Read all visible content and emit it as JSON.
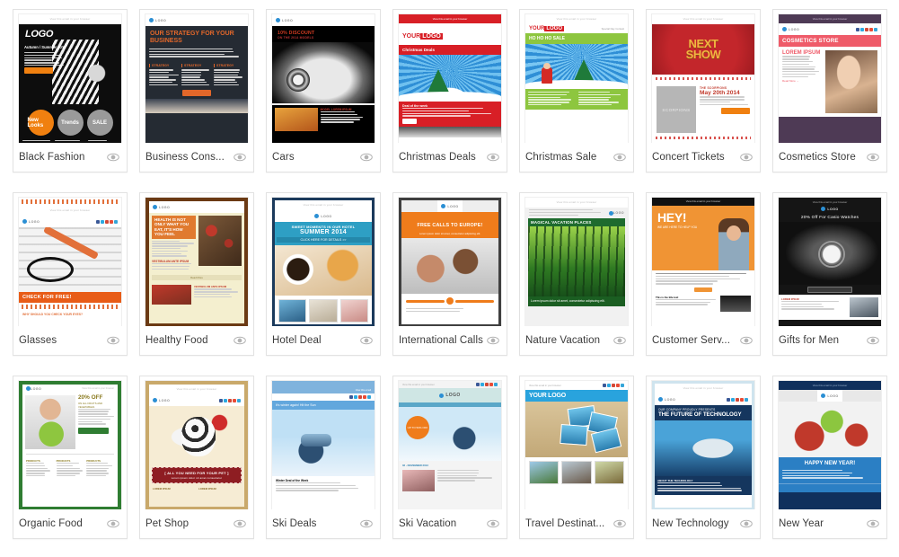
{
  "page": {
    "background": "#ffffff",
    "grid": {
      "columns": 7,
      "rows": 3
    },
    "preview_icon": "eye-icon",
    "preheader_text": "View this email in your browser"
  },
  "templates": [
    {
      "id": "black-fashion",
      "label": "Black Fashion",
      "style": "t-black",
      "accent": "#f08010",
      "thumb": {
        "logo": "LOGO",
        "heading": "Autumn / Summer 2014",
        "badges": [
          "New Looks",
          "Trends",
          "SALE"
        ],
        "cta": "View more"
      }
    },
    {
      "id": "business-consulting",
      "label": "Business Cons...",
      "style": "t-biz",
      "accent": "#e2672a",
      "thumb": {
        "logo": "LOGO",
        "heading": "OUR STRATEGY FOR YOUR BUSINESS",
        "columns": [
          "STRATEGY",
          "STRATEGY",
          "STRATEGY"
        ],
        "cta": "Read more"
      }
    },
    {
      "id": "cars",
      "label": "Cars",
      "style": "t-car",
      "accent": "#d23b22",
      "thumb": {
        "logo": "LOGO",
        "heading": "10% DISCOUNT",
        "sub": "ON THE 2014 MODELS",
        "section": "MODEL LOREM IPSUM"
      }
    },
    {
      "id": "christmas-deals",
      "label": "Christmas Deals",
      "style": "t-xdeal",
      "accent": "#d81f26",
      "thumb": {
        "logo": "YOUR LOGO",
        "heading": "Christmas Deals",
        "section": "Deal of the week",
        "cta": "Buy now"
      }
    },
    {
      "id": "christmas-sale",
      "label": "Christmas Sale",
      "style": "t-xsale",
      "accent": "#8dc63f",
      "thumb": {
        "logo": "YOUR LOGO",
        "heading": "HO HO HO SALE",
        "nav": "Special Day Contact"
      }
    },
    {
      "id": "concert-tickets",
      "label": "Concert Tickets",
      "style": "t-concert",
      "accent": "#c3262b",
      "thumb": {
        "heading": "NEXT SHOW",
        "artist": "THE SCORPIONS",
        "date": "May 20th 2014",
        "poster": "SCORPIONS",
        "cta": "Order now"
      }
    },
    {
      "id": "cosmetics-store",
      "label": "Cosmetics Store",
      "style": "t-cos",
      "accent": "#ef5b69",
      "thumb": {
        "logo": "LOGO",
        "heading": "COSMETICS STORE",
        "sub": "LOREM IPSUM",
        "cta": "Read More"
      }
    },
    {
      "id": "glasses",
      "label": "Glasses",
      "style": "t-glass",
      "accent": "#e85c17",
      "thumb": {
        "logo": "LOGO",
        "heading": "CHECK FOR FREE!",
        "footer": "WHY SHOULD YOU CHECK YOUR EYES?"
      }
    },
    {
      "id": "healthy-food",
      "label": "Healthy Food",
      "style": "t-health",
      "accent": "#e07a2f",
      "thumb": {
        "logo": "LOGO",
        "heading": "HEALTH IS NOT ONLY WHAT YOU EAT, IT'S HOW YOU FEEL",
        "section": "VESTIBULUM ANTE IPSUM",
        "cta": "Read More"
      }
    },
    {
      "id": "hotel-deal",
      "label": "Hotel Deal",
      "style": "t-hotel",
      "accent": "#2e9fc4",
      "thumb": {
        "logo": "LOGO",
        "heading": "SWEET MOMENTS IN OUR HOTEL",
        "sub": "SUMMER 2014",
        "cta": "CLICK HERE FOR DETAILS >>"
      }
    },
    {
      "id": "international-calls",
      "label": "International Calls",
      "style": "t-intl",
      "accent": "#ef7c1b",
      "thumb": {
        "logo": "LOGO",
        "heading": "FREE CALLS TO EUROPE!",
        "sub": "Lorem ipsum dolor sit amet, consectetur adipiscing elit."
      }
    },
    {
      "id": "nature-vacation",
      "label": "Nature Vacation",
      "style": "t-nat",
      "accent": "#1e6b2e",
      "thumb": {
        "logo": "LOGO",
        "heading": "MAGICAL VACATION PLACES",
        "footer": "Lorem ipsum dolor sit amet, consectetur adipiscing elit."
      }
    },
    {
      "id": "customer-service",
      "label": "Customer Serv...",
      "style": "t-cust",
      "accent": "#f09434",
      "thumb": {
        "heading": "HEY!",
        "sub": "WE ARE HERE TO HELP YOU",
        "section": "This is the title text",
        "cta": "READ MORE"
      }
    },
    {
      "id": "gifts-for-men",
      "label": "Gifts for Men",
      "style": "t-gift",
      "accent": "#9a9a9a",
      "thumb": {
        "logo": "LOGO",
        "heading": "20% Off For Casio Watches",
        "section": "LOREM IPSUM",
        "cta": "Find Thousands more items"
      }
    },
    {
      "id": "organic-food",
      "label": "Organic Food",
      "style": "t-org",
      "accent": "#2f7d32",
      "thumb": {
        "logo": "LOGO",
        "heading": "20% OFF",
        "sub": "ON ALL FRUITS AND VEGETABLES",
        "columns": [
          "PRODUCTS",
          "PRODUCTS",
          "PRODUCTS"
        ],
        "cta": "Click Here >>"
      }
    },
    {
      "id": "pet-shop",
      "label": "Pet Shop",
      "style": "t-pet",
      "accent": "#8e1d22",
      "thumb": {
        "logo": "LOGO",
        "heading": "[ ALL YOU NEED FOR YOUR PET ]",
        "columns": [
          "LOREM IPSUM",
          "LOREM IPSUM"
        ]
      }
    },
    {
      "id": "ski-deals",
      "label": "Ski Deals",
      "style": "t-ski",
      "accent": "#62a7dd",
      "thumb": {
        "heading": "It's winter again! Hit the Sun",
        "section": "Winter Deal of the Week",
        "nav": "View this email"
      }
    },
    {
      "id": "ski-vacation",
      "label": "Ski Vacation",
      "style": "t-skiv",
      "accent": "#5aa7c8",
      "thumb": {
        "logo": "LOGO",
        "badge": "UP TO 50% OFF",
        "section": "02 - NOVEMBER 2013"
      }
    },
    {
      "id": "travel-destinations",
      "label": "Travel Destinat...",
      "style": "t-trav",
      "accent": "#29a3dd",
      "thumb": {
        "logo": "YOUR LOGO"
      }
    },
    {
      "id": "new-technology",
      "label": "New Technology",
      "style": "t-tech",
      "accent": "#15365e",
      "thumb": {
        "logo": "LOGO",
        "heading": "OUR COMPANY PROUDLY PRESENTS",
        "sub": "THE FUTURE OF TECHNOLOGY",
        "footer": "ABOUT THE TECHNOLOGY"
      }
    },
    {
      "id": "new-year",
      "label": "New Year",
      "style": "t-ny",
      "accent": "#2b7fc4",
      "thumb": {
        "logo": "LOGO",
        "heading": "HAPPY NEW YEAR!"
      }
    }
  ]
}
